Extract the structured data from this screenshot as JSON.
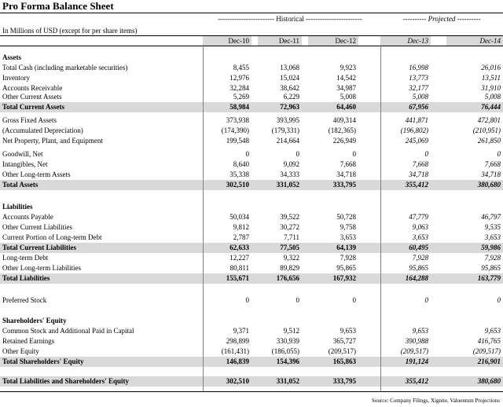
{
  "title": "Pro Forma Balance Sheet",
  "groups": {
    "historical": "------------------------ Historical ------------------------",
    "projected": "---------- Projected ----------"
  },
  "units": "In Millions of USD (except for per share items)",
  "columns": [
    "Dec-10",
    "Dec-11",
    "Dec-12",
    "Dec-13",
    "Dec-14"
  ],
  "projected_columns": [
    "Dec-13",
    "Dec-14"
  ],
  "rows": [
    {
      "label": "Assets",
      "type": "header",
      "values": [
        "",
        "",
        "",
        "",
        ""
      ]
    },
    {
      "label": "Total Cash (including marketable securities)",
      "type": "item",
      "values": [
        "8,455",
        "13,068",
        "9,923",
        "16,998",
        "26,016"
      ]
    },
    {
      "label": "Inventory",
      "type": "item",
      "values": [
        "12,976",
        "15,024",
        "14,542",
        "13,773",
        "13,511"
      ]
    },
    {
      "label": "Accounts Receivable",
      "type": "item",
      "values": [
        "32,284",
        "38,642",
        "34,987",
        "32,177",
        "31,910"
      ]
    },
    {
      "label": "Other Current Assets",
      "type": "item",
      "values": [
        "5,269",
        "6,229",
        "5,008",
        "5,008",
        "5,008"
      ]
    },
    {
      "label": "Total Current Assets",
      "type": "total",
      "values": [
        "58,984",
        "72,963",
        "64,460",
        "67,956",
        "76,444"
      ]
    },
    {
      "label": "Gross Fixed Assets",
      "type": "item",
      "values": [
        "373,938",
        "393,995",
        "409,314",
        "441,871",
        "472,801"
      ]
    },
    {
      "label": "(Accumulated Depreciation)",
      "type": "item",
      "values": [
        "(174,390)",
        "(179,331)",
        "(182,365)",
        "(196,802)",
        "(210,951)"
      ]
    },
    {
      "label": "Net Property, Plant, and Equipment",
      "type": "item",
      "values": [
        "199,548",
        "214,664",
        "226,949",
        "245,069",
        "261,850"
      ]
    },
    {
      "label": "Goodwill, Net",
      "type": "item",
      "values": [
        "0",
        "0",
        "0",
        "0",
        "0"
      ]
    },
    {
      "label": "Intangibles, Net",
      "type": "item",
      "values": [
        "8,640",
        "9,092",
        "7,668",
        "7,668",
        "7,668"
      ]
    },
    {
      "label": "Other Long-term Assets",
      "type": "item",
      "values": [
        "35,338",
        "34,333",
        "34,718",
        "34,718",
        "34,718"
      ]
    },
    {
      "label": "Total Assets",
      "type": "total",
      "values": [
        "302,510",
        "331,052",
        "333,795",
        "355,412",
        "380,680"
      ]
    },
    {
      "label": "Liabilities",
      "type": "header",
      "values": [
        "",
        "",
        "",
        "",
        ""
      ]
    },
    {
      "label": "Accounts Payable",
      "type": "item",
      "values": [
        "50,034",
        "39,522",
        "50,728",
        "47,779",
        "46,797"
      ]
    },
    {
      "label": "Other Current Liabilities",
      "type": "item",
      "values": [
        "9,812",
        "30,272",
        "9,758",
        "9,063",
        "9,535"
      ]
    },
    {
      "label": "Current Portion of Long-term Debt",
      "type": "item",
      "values": [
        "2,787",
        "7,711",
        "3,653",
        "3,653",
        "3,653"
      ]
    },
    {
      "label": "Total Current Liabilities",
      "type": "total",
      "values": [
        "62,633",
        "77,505",
        "64,139",
        "60,495",
        "59,986"
      ]
    },
    {
      "label": "Long-term Debt",
      "type": "item",
      "values": [
        "12,227",
        "9,322",
        "7,928",
        "7,928",
        "7,928"
      ]
    },
    {
      "label": "Other Long-term Liabilities",
      "type": "item",
      "values": [
        "80,811",
        "89,829",
        "95,865",
        "95,865",
        "95,865"
      ]
    },
    {
      "label": "Total Liabilities",
      "type": "total",
      "values": [
        "155,671",
        "176,656",
        "167,932",
        "164,288",
        "163,779"
      ]
    },
    {
      "label": "Preferred Stock",
      "type": "item",
      "values": [
        "0",
        "0",
        "0",
        "0",
        "0"
      ]
    },
    {
      "label": "Shareholders' Equity",
      "type": "header",
      "values": [
        "",
        "",
        "",
        "",
        ""
      ]
    },
    {
      "label": "Common Stock and Additional Paid in Capital",
      "type": "item",
      "values": [
        "9,371",
        "9,512",
        "9,653",
        "9,653",
        "9,653"
      ]
    },
    {
      "label": "Retained Earnings",
      "type": "item",
      "values": [
        "298,899",
        "330,939",
        "365,727",
        "390,988",
        "416,765"
      ]
    },
    {
      "label": "Other Equity",
      "type": "item",
      "values": [
        "(161,431)",
        "(186,055)",
        "(209,517)",
        "(209,517)",
        "(209,517)"
      ]
    },
    {
      "label": "Total Shareholders' Equity",
      "type": "total",
      "values": [
        "146,839",
        "154,396",
        "165,863",
        "191,124",
        "216,901"
      ]
    },
    {
      "label": "Total Liabilities and Shareholders' Equity",
      "type": "total",
      "values": [
        "302,510",
        "331,052",
        "333,795",
        "355,412",
        "380,680"
      ]
    }
  ],
  "source": "Source: Company Filings, Xignite, Valuentum Projections"
}
